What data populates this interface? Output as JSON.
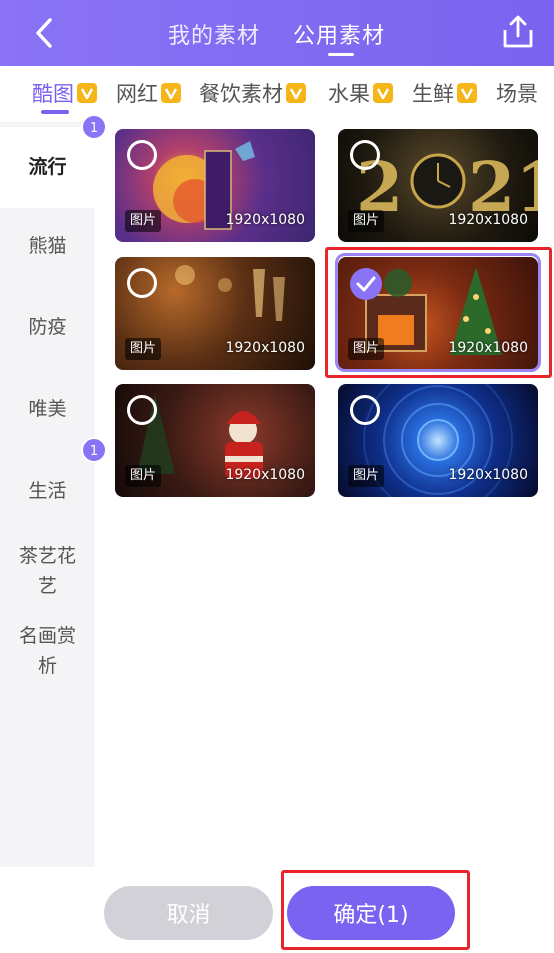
{
  "header": {
    "tab_mine": "我的素材",
    "tab_public": "公用素材",
    "back_icon": "chevron-left-icon",
    "share_icon": "upload-icon"
  },
  "categories": [
    "酷图",
    "网红",
    "餐饮素材",
    "水果",
    "生鲜",
    "场景"
  ],
  "active_category": "酷图",
  "sidebar": {
    "items": [
      "流行",
      "熊猫",
      "防疫",
      "唯美",
      "生活",
      "茶艺花艺",
      "名画赏析"
    ],
    "items_display": [
      "流行",
      "熊猫",
      "防疫",
      "唯美",
      "生活",
      "茶艺花\n艺",
      "名画赏\n析"
    ],
    "badge_top": "1",
    "badge_bottom": "1"
  },
  "images": [
    {
      "tag": "图片",
      "size": "1920x1080",
      "selected": false
    },
    {
      "tag": "图片",
      "size": "1920x1080",
      "selected": false
    },
    {
      "tag": "图片",
      "size": "1920x1080",
      "selected": false
    },
    {
      "tag": "图片",
      "size": "1920x1080",
      "selected": true
    },
    {
      "tag": "图片",
      "size": "1920x1080",
      "selected": false
    },
    {
      "tag": "图片",
      "size": "1920x1080",
      "selected": false
    }
  ],
  "footer": {
    "cancel_label": "取消",
    "confirm_label": "确定(1)"
  },
  "colors": {
    "accent": "#7a63f1",
    "vip_badge": "#f6b519",
    "highlight": "#e8252a"
  }
}
